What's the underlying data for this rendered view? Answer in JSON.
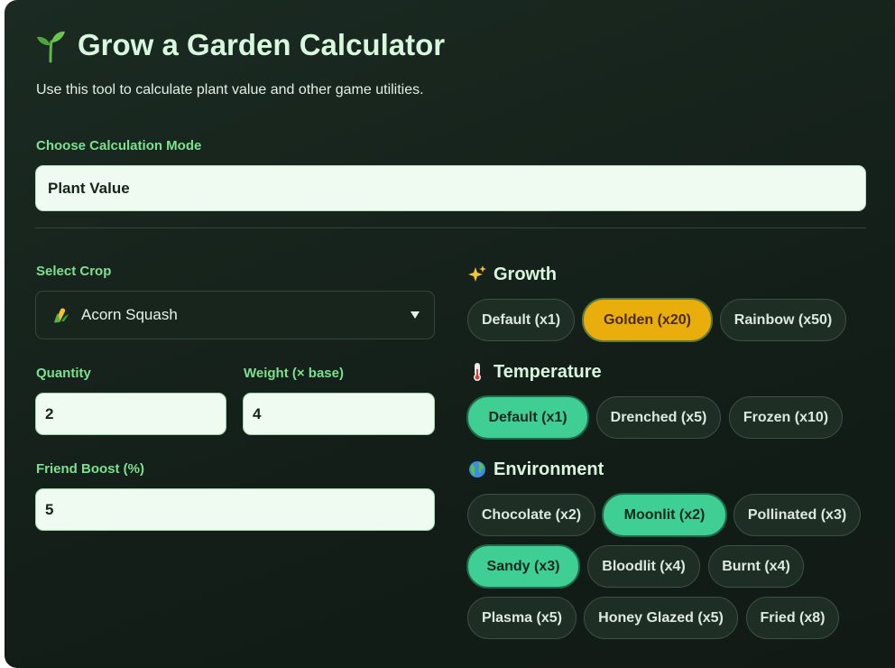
{
  "header": {
    "title": "Grow a Garden Calculator",
    "subtitle": "Use this tool to calculate plant value and other game utilities."
  },
  "mode": {
    "label": "Choose Calculation Mode",
    "value": "Plant Value"
  },
  "crop": {
    "label": "Select Crop",
    "value": "Acorn Squash",
    "icon": "corn-icon"
  },
  "quantity": {
    "label": "Quantity",
    "value": "2"
  },
  "weight": {
    "label": "Weight (× base)",
    "value": "4"
  },
  "friend_boost": {
    "label": "Friend Boost (%)",
    "value": "5"
  },
  "growth": {
    "heading": "Growth",
    "icon": "sparkles-icon",
    "options": [
      "Default (x1)",
      "Golden (x20)",
      "Rainbow (x50)"
    ],
    "selected": "Golden (x20)"
  },
  "temperature": {
    "heading": "Temperature",
    "icon": "thermometer-icon",
    "options": [
      "Default (x1)",
      "Drenched (x5)",
      "Frozen (x10)"
    ],
    "selected": "Default (x1)"
  },
  "environment": {
    "heading": "Environment",
    "icon": "globe-icon",
    "options": [
      "Chocolate (x2)",
      "Moonlit (x2)",
      "Pollinated (x3)",
      "Sandy (x3)",
      "Bloodlit (x4)",
      "Burnt (x4)",
      "Plasma (x5)",
      "Honey Glazed (x5)",
      "Fried (x8)"
    ],
    "selected": [
      "Moonlit (x2)",
      "Sandy (x3)"
    ]
  },
  "colors": {
    "accent_green": "#3fcf94",
    "accent_gold": "#e9ad0c",
    "label_green": "#7ee08f",
    "background": "#16231c"
  }
}
